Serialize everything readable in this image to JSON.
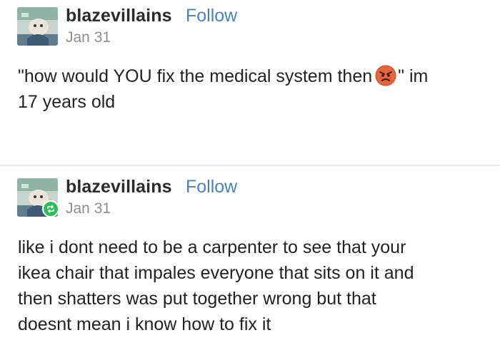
{
  "posts": [
    {
      "username": "blazevillains",
      "follow_label": "Follow",
      "date": "Jan 31",
      "text_before_emoji": "\"how would YOU fix the medical system then",
      "emoji": "angry-face-emoji",
      "text_after_emoji": "\" im",
      "text_line2": "17 years old"
    },
    {
      "username": "blazevillains",
      "follow_label": "Follow",
      "date": "Jan 31",
      "reblogged": true,
      "lines": [
        "like i dont need to be a carpenter to see that your",
        "ikea chair that impales everyone that sits on it and",
        "then shatters was put together wrong but that",
        "doesnt mean i know how to fix it"
      ]
    }
  ],
  "colors": {
    "follow_link": "#4a7fc1",
    "date_text": "#8c8c8c",
    "reblog_badge": "#2fbf5a",
    "divider": "#e6e6e6"
  },
  "icons": {
    "reblog": "reblog-icon",
    "emoji": "angry-face-emoji"
  }
}
